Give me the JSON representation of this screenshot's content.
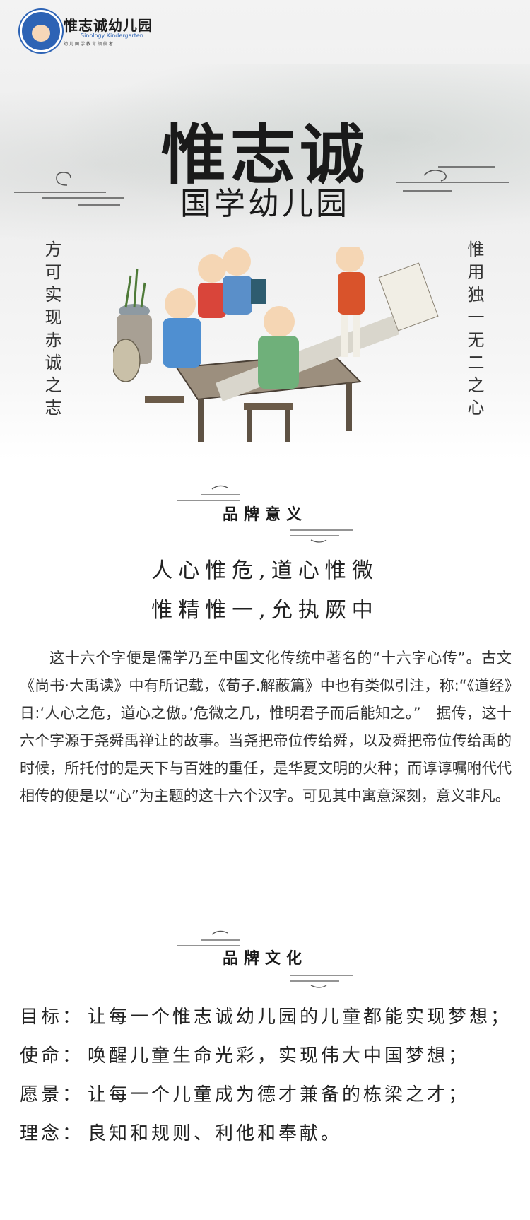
{
  "logo": {
    "name": "惟志诚幼儿园",
    "english": "Sinology Kindergarten",
    "tagline": "幼儿国学教育领航者"
  },
  "hero": {
    "title": "惟志诚",
    "subtitle": "国学幼儿园",
    "left_vertical": "方可实现赤诚之志",
    "right_vertical": "惟用独一无二之心"
  },
  "brand_meaning": {
    "heading": "品牌意义",
    "quote_line1": "人心惟危,道心惟微",
    "quote_line2": "惟精惟一,允执厥中",
    "paragraph": "这十六个字便是儒学乃至中国文化传统中著名的“十六字心传”。古文《尚书·大禹读》中有所记载，《荀子.解蔽篇》中也有类似引注，称:“《道经》日:‘人心之危，道心之傲。’危微之几，惟明君子而后能知之。”　据传，这十六个字源于尧舜禹禅让的故事。当尧把帝位传给舜，以及舜把帝位传给禹的时候，所托付的是天下与百姓的重任，是华夏文明的火种；而谆谆嘱咐代代相传的便是以“心”为主题的这十六个汉字。可见其中寓意深刻，意义非凡。"
  },
  "brand_culture": {
    "heading": "品牌文化",
    "items": [
      {
        "key": "目标：",
        "value": "让每一个惟志诚幼儿园的儿童都能实现梦想；"
      },
      {
        "key": "使命：",
        "value": "唤醒儿童生命光彩，实现伟大中国梦想；"
      },
      {
        "key": "愿景：",
        "value": "让每一个儿童成为德才兼备的栋梁之才；"
      },
      {
        "key": "理念：",
        "value": "良知和规则、利他和奉献。"
      }
    ]
  },
  "colors": {
    "ink": "#1a1a1a",
    "logo_blue": "#2d63b5"
  }
}
